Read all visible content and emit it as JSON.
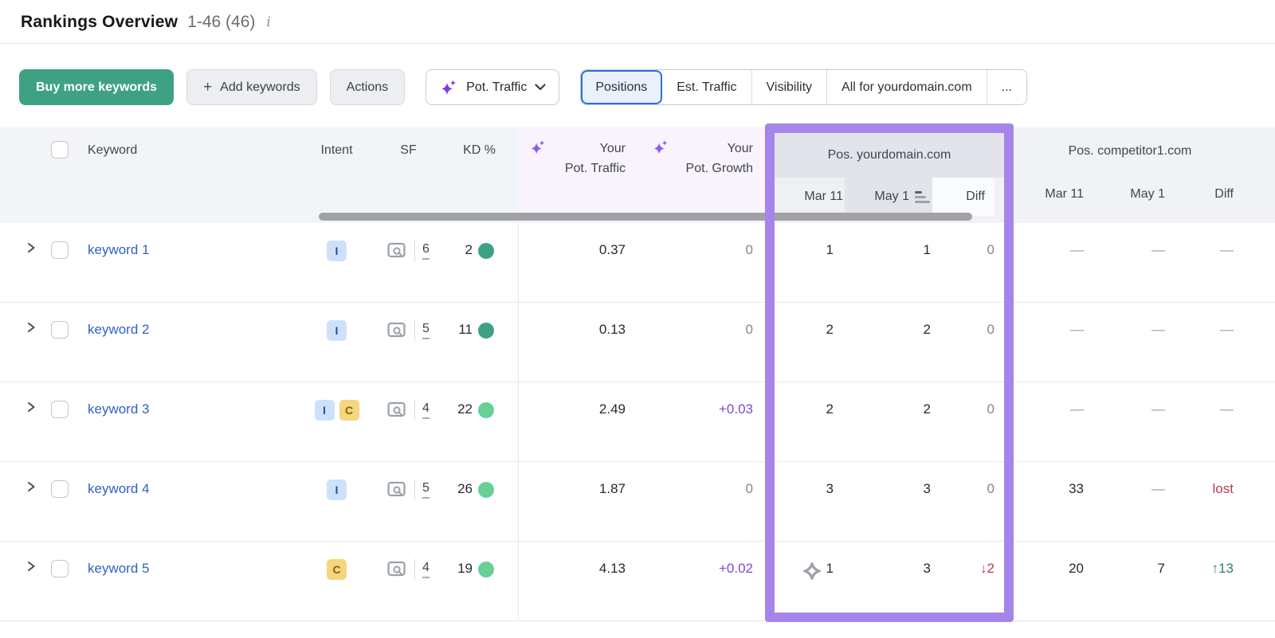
{
  "page": {
    "title": "Rankings Overview",
    "range": "1-46 (46)"
  },
  "icons": {
    "info": "i",
    "plus": "+",
    "ellipsis_tab": "...",
    "sparkle": "sparkle-icon",
    "chevron_down": "chevron-down-icon",
    "chevron_right": "chevron-right-icon",
    "serp_preview": "serp-preview-icon",
    "sort_desc": "sort-descending-icon",
    "ai_estimate": "ai-estimate-quatrefoil-icon"
  },
  "toolbar": {
    "buy_label": "Buy more keywords",
    "add_label": "Add keywords",
    "actions_label": "Actions",
    "metric_dropdown_label": "Pot. Traffic",
    "tabs": [
      "Positions",
      "Est. Traffic",
      "Visibility",
      "All for yourdomain.com",
      "..."
    ],
    "active_tab": "Positions"
  },
  "table": {
    "columns": {
      "keyword": "Keyword",
      "intent": "Intent",
      "sf": "SF",
      "kd": "KD %",
      "pot_traffic_l1": "Your",
      "pot_traffic_l2": "Pot. Traffic",
      "pot_growth_l1": "Your",
      "pot_growth_l2": "Pot. Growth"
    },
    "groups": {
      "your": {
        "label": "Pos. yourdomain.com",
        "d1": "Mar 11",
        "d2": "May 1",
        "d3": "Diff",
        "sorted_by": "May 1"
      },
      "comp": {
        "label": "Pos. competitor1.com",
        "d1": "Mar 11",
        "d2": "May 1",
        "d3": "Diff"
      }
    },
    "rows": [
      {
        "keyword": "keyword 1",
        "intents": [
          "I"
        ],
        "sf": "6",
        "kd": "2",
        "pot_traffic": "0.37",
        "pot_growth": "0",
        "your": [
          "1",
          "1",
          "0"
        ],
        "comp": [
          "—",
          "—",
          "—"
        ]
      },
      {
        "keyword": "keyword 2",
        "intents": [
          "I"
        ],
        "sf": "5",
        "kd": "11",
        "pot_traffic": "0.13",
        "pot_growth": "0",
        "your": [
          "2",
          "2",
          "0"
        ],
        "comp": [
          "—",
          "—",
          "—"
        ]
      },
      {
        "keyword": "keyword 3",
        "intents": [
          "I",
          "C"
        ],
        "sf": "4",
        "kd": "22",
        "pot_traffic": "2.49",
        "pot_growth": "+0.03",
        "your": [
          "2",
          "2",
          "0"
        ],
        "comp": [
          "—",
          "—",
          "—"
        ]
      },
      {
        "keyword": "keyword 4",
        "intents": [
          "I"
        ],
        "sf": "5",
        "kd": "26",
        "pot_traffic": "1.87",
        "pot_growth": "0",
        "your": [
          "3",
          "3",
          "0"
        ],
        "comp": [
          "33",
          "—",
          "lost"
        ]
      },
      {
        "keyword": "keyword 5",
        "intents": [
          "C"
        ],
        "sf": "4",
        "kd": "19",
        "pot_traffic": "4.13",
        "pot_growth": "+0.02",
        "your": [
          "1",
          "3",
          "↓2"
        ],
        "comp": [
          "20",
          "7",
          "↑13"
        ]
      }
    ]
  },
  "colors": {
    "highlight_purple": "#a685ea",
    "buy_button_green": "#3fa183",
    "link_blue": "#2f63c5",
    "growth_purple": "#7c49d6",
    "diff_red": "#b93c51",
    "diff_green": "#33836a",
    "kd_dot_dark_green": "#3fa183",
    "kd_dot_light_green": "#68cf96",
    "intent_informational_bg": "#cde2fa",
    "intent_commercial_bg": "#f5d57d",
    "active_tab_blue_border": "#2f6fd8",
    "active_tab_blue_bg": "#e8f1fc"
  }
}
